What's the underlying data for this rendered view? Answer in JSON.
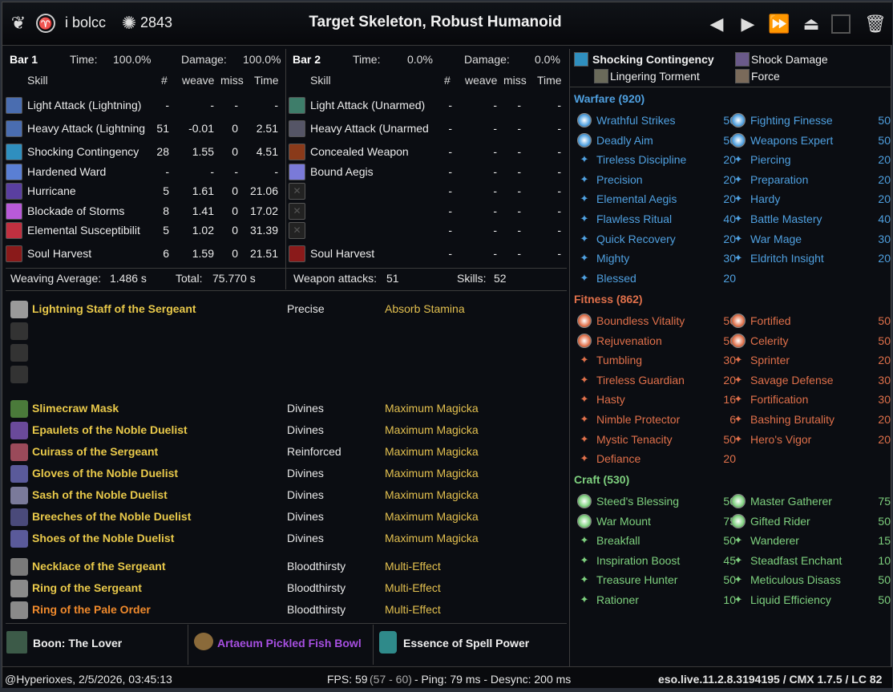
{
  "header": {
    "icons": [
      "class-icon",
      "alliance-icon",
      "cp-icon"
    ],
    "player": "i bolcc",
    "cp": "2843",
    "title": "Target Skeleton, Robust Humanoid"
  },
  "bar1": {
    "label": "Bar 1",
    "time_label": "Time:",
    "time": "100.0%",
    "damage_label": "Damage:",
    "damage": "100.0%",
    "cols": [
      "Skill",
      "#",
      "weave",
      "miss",
      "Time"
    ],
    "rows": [
      {
        "name": "Light Attack (Lightning)",
        "n": "-",
        "weave": "-",
        "miss": "-",
        "time": "-",
        "color": "#4a6db0"
      },
      {
        "name": "Heavy Attack (Lightning",
        "n": "51",
        "weave": "-0.01",
        "miss": "0",
        "time": "2.51",
        "color": "#4a6db0"
      },
      {
        "name": "Shocking Contingency",
        "n": "28",
        "weave": "1.55",
        "miss": "0",
        "time": "4.51",
        "color": "#2f8fbf"
      },
      {
        "name": "Hardened Ward",
        "n": "-",
        "weave": "-",
        "miss": "-",
        "time": "-",
        "color": "#5a7fd4"
      },
      {
        "name": "Hurricane",
        "n": "5",
        "weave": "1.61",
        "miss": "0",
        "time": "21.06",
        "color": "#5a3fa0"
      },
      {
        "name": "Blockade of Storms",
        "n": "8",
        "weave": "1.41",
        "miss": "0",
        "time": "17.02",
        "color": "#b85ad8"
      },
      {
        "name": "Elemental Susceptibilit",
        "n": "5",
        "weave": "1.02",
        "miss": "0",
        "time": "31.39",
        "color": "#c03040"
      },
      {
        "name": "Soul Harvest",
        "n": "6",
        "weave": "1.59",
        "miss": "0",
        "time": "21.51",
        "color": "#8a1a1a"
      }
    ]
  },
  "bar2": {
    "label": "Bar 2",
    "time_label": "Time:",
    "time": "0.0%",
    "damage_label": "Damage:",
    "damage": "0.0%",
    "cols": [
      "Skill",
      "#",
      "weave",
      "miss",
      "Time"
    ],
    "rows": [
      {
        "name": "Light Attack (Unarmed)",
        "n": "-",
        "weave": "-",
        "miss": "-",
        "time": "-",
        "color": "#3e7d6a"
      },
      {
        "name": "Heavy Attack (Unarmed",
        "n": "-",
        "weave": "-",
        "miss": "-",
        "time": "-",
        "color": "#556"
      },
      {
        "name": "Concealed Weapon",
        "n": "-",
        "weave": "-",
        "miss": "-",
        "time": "-",
        "color": "#8a3a1a"
      },
      {
        "name": "Bound Aegis",
        "n": "-",
        "weave": "-",
        "miss": "-",
        "time": "-",
        "color": "#7a7ad8"
      },
      {
        "name": "",
        "n": "-",
        "weave": "-",
        "miss": "-",
        "time": "-",
        "color": "#222"
      },
      {
        "name": "",
        "n": "-",
        "weave": "-",
        "miss": "-",
        "time": "-",
        "color": "#222"
      },
      {
        "name": "",
        "n": "-",
        "weave": "-",
        "miss": "-",
        "time": "-",
        "color": "#222"
      },
      {
        "name": "Soul Harvest",
        "n": "-",
        "weave": "-",
        "miss": "-",
        "time": "-",
        "color": "#8a1a1a"
      }
    ]
  },
  "stats": {
    "weaving_label": "Weaving Average:",
    "weaving": "1.486 s",
    "total_label": "Total:",
    "total": "75.770 s",
    "weapon_label": "Weapon attacks:",
    "weapon": "51",
    "skills_label": "Skills:",
    "skills": "52"
  },
  "gear": [
    {
      "name": "Lightning Staff of the Sergeant",
      "trait": "Precise",
      "ench": "Absorb Stamina",
      "color": "#e9c94a"
    },
    {
      "name": "",
      "trait": "",
      "ench": "",
      "color": "#e9c94a"
    },
    {
      "name": "",
      "trait": "",
      "ench": "",
      "color": "#e9c94a"
    },
    {
      "name": "",
      "trait": "",
      "ench": "",
      "color": "#e9c94a"
    },
    {
      "name": "Slimecraw Mask",
      "trait": "Divines",
      "ench": "Maximum Magicka",
      "color": "#e9c94a"
    },
    {
      "name": "Epaulets of the Noble Duelist",
      "trait": "Divines",
      "ench": "Maximum Magicka",
      "color": "#e9c94a"
    },
    {
      "name": "Cuirass of the Sergeant",
      "trait": "Reinforced",
      "ench": "Maximum Magicka",
      "color": "#e9c94a"
    },
    {
      "name": "Gloves of the Noble Duelist",
      "trait": "Divines",
      "ench": "Maximum Magicka",
      "color": "#e9c94a"
    },
    {
      "name": "Sash of the Noble Duelist",
      "trait": "Divines",
      "ench": "Maximum Magicka",
      "color": "#e9c94a"
    },
    {
      "name": "Breeches of the Noble Duelist",
      "trait": "Divines",
      "ench": "Maximum Magicka",
      "color": "#e9c94a"
    },
    {
      "name": "Shoes of the Noble Duelist",
      "trait": "Divines",
      "ench": "Maximum Magicka",
      "color": "#e9c94a"
    },
    {
      "name": "Necklace of the Sergeant",
      "trait": "Bloodthirsty",
      "ench": "Multi-Effect",
      "color": "#e9c94a"
    },
    {
      "name": "Ring of the Sergeant",
      "trait": "Bloodthirsty",
      "ench": "Multi-Effect",
      "color": "#e9c94a"
    },
    {
      "name": "Ring of the Pale Order",
      "trait": "Bloodthirsty",
      "ench": "Multi-Effect",
      "color": "#f08a2c"
    }
  ],
  "buffs": {
    "boon": "Boon: The Lover",
    "food": "Artaeum Pickled Fish Bowl",
    "potion": "Essence of Spell Power"
  },
  "right_top": {
    "item1": "Shocking Contingency",
    "item2": "Shock Damage",
    "item3": "Lingering Torment",
    "item4": "Force"
  },
  "cp": {
    "warfare": {
      "title": "Warfare (920)",
      "color": "#4fa0e0",
      "left": [
        {
          "name": "Wrathful Strikes",
          "v": "50"
        },
        {
          "name": "Deadly Aim",
          "v": "50"
        },
        {
          "name": "Tireless Discipline",
          "v": "20"
        },
        {
          "name": "Precision",
          "v": "20"
        },
        {
          "name": "Elemental Aegis",
          "v": "20"
        },
        {
          "name": "Flawless Ritual",
          "v": "40"
        },
        {
          "name": "Quick Recovery",
          "v": "20"
        },
        {
          "name": "Mighty",
          "v": "30"
        },
        {
          "name": "Blessed",
          "v": "20"
        }
      ],
      "right": [
        {
          "name": "Fighting Finesse",
          "v": "50"
        },
        {
          "name": "Weapons Expert",
          "v": "50"
        },
        {
          "name": "Piercing",
          "v": "20"
        },
        {
          "name": "Preparation",
          "v": "20"
        },
        {
          "name": "Hardy",
          "v": "20"
        },
        {
          "name": "Battle Mastery",
          "v": "40"
        },
        {
          "name": "War Mage",
          "v": "30"
        },
        {
          "name": "Eldritch Insight",
          "v": "20"
        }
      ]
    },
    "fitness": {
      "title": "Fitness (862)",
      "color": "#e0704a",
      "left": [
        {
          "name": "Boundless Vitality",
          "v": "50"
        },
        {
          "name": "Rejuvenation",
          "v": "50"
        },
        {
          "name": "Tumbling",
          "v": "30"
        },
        {
          "name": "Tireless Guardian",
          "v": "20"
        },
        {
          "name": "Hasty",
          "v": "16"
        },
        {
          "name": "Nimble Protector",
          "v": "6"
        },
        {
          "name": "Mystic Tenacity",
          "v": "50"
        },
        {
          "name": "Defiance",
          "v": "20"
        }
      ],
      "right": [
        {
          "name": "Fortified",
          "v": "50"
        },
        {
          "name": "Celerity",
          "v": "50"
        },
        {
          "name": "Sprinter",
          "v": "20"
        },
        {
          "name": "Savage Defense",
          "v": "30"
        },
        {
          "name": "Fortification",
          "v": "30"
        },
        {
          "name": "Bashing Brutality",
          "v": "20"
        },
        {
          "name": "Hero's Vigor",
          "v": "20"
        }
      ]
    },
    "craft": {
      "title": "Craft (530)",
      "color": "#7ed07e",
      "left": [
        {
          "name": "Steed's Blessing",
          "v": "50"
        },
        {
          "name": "War Mount",
          "v": "75"
        },
        {
          "name": "Breakfall",
          "v": "50"
        },
        {
          "name": "Inspiration Boost",
          "v": "45"
        },
        {
          "name": "Treasure Hunter",
          "v": "50"
        },
        {
          "name": "Rationer",
          "v": "10"
        }
      ],
      "right": [
        {
          "name": "Master Gatherer",
          "v": "75"
        },
        {
          "name": "Gifted Rider",
          "v": "50"
        },
        {
          "name": "Wanderer",
          "v": "15"
        },
        {
          "name": "Steadfast Enchant",
          "v": "10"
        },
        {
          "name": "Meticulous Disass",
          "v": "50"
        },
        {
          "name": "Liquid Efficiency",
          "v": "50"
        }
      ]
    }
  },
  "footer": {
    "user": "@Hyperioxes, 2/5/2026, 03:45:13",
    "fps": "FPS: 59",
    "fps_range": "(57 - 60)",
    "ping": "- Ping: 79 ms - Desync: 200 ms",
    "version": "eso.live.11.2.8.3194195 / CMX 1.7.5 / LC 82"
  }
}
